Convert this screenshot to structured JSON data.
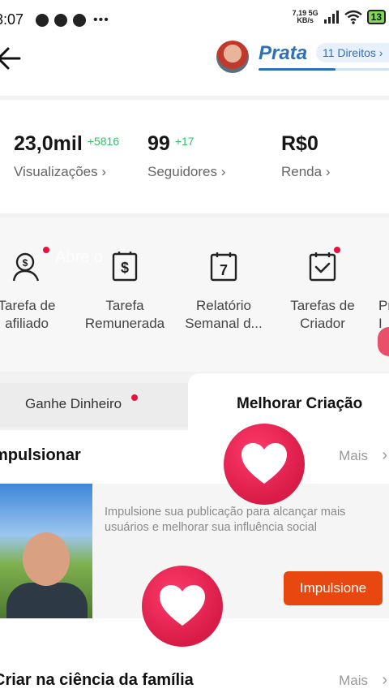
{
  "status_bar": {
    "time": "3:07",
    "net_speed_value": "7,19",
    "net_speed_unit": "KB/s",
    "network_type": "5G",
    "battery": "13"
  },
  "header": {
    "level_name": "Prata",
    "rights_label": "11 Direitos",
    "level_progress": 0.59
  },
  "stats": [
    {
      "value": "23,0mil",
      "delta": "+5816",
      "label": "Visualizações"
    },
    {
      "value": "99",
      "delta": "+17",
      "label": "Seguidores"
    },
    {
      "value": "R$0",
      "delta": "",
      "label": "Renda"
    }
  ],
  "tools": [
    {
      "line1": "Tarefa de",
      "line2": "afiliado",
      "icon": "affiliate-icon"
    },
    {
      "line1": "Tarefa",
      "line2": "Remunerada",
      "icon": "paid-task-icon"
    },
    {
      "line1": "Relatório",
      "line2": "Semanal d...",
      "icon": "calendar-icon"
    },
    {
      "line1": "Tarefas de",
      "line2": "Criador",
      "icon": "creator-task-icon"
    },
    {
      "line1": "Pr",
      "line2": "I",
      "icon": "more-tool-icon"
    }
  ],
  "overlay_text": "Abre o",
  "tabs": {
    "earn": "Ganhe Dinheiro",
    "improve": "Melhorar Criação"
  },
  "boost_section": {
    "title": "mpulsionar",
    "more": "Mais",
    "description": "Impulsione sua publicação para alcançar mais usuários e melhorar sua influência social",
    "button": "Impulsione"
  },
  "family_section": {
    "title": "Criar na ciência da família",
    "more": "Mais"
  },
  "colors": {
    "accent_blue": "#2f6fba",
    "delta_green": "#2dc36a",
    "button_orange": "#e8470f",
    "notification_red": "#e8113c"
  }
}
